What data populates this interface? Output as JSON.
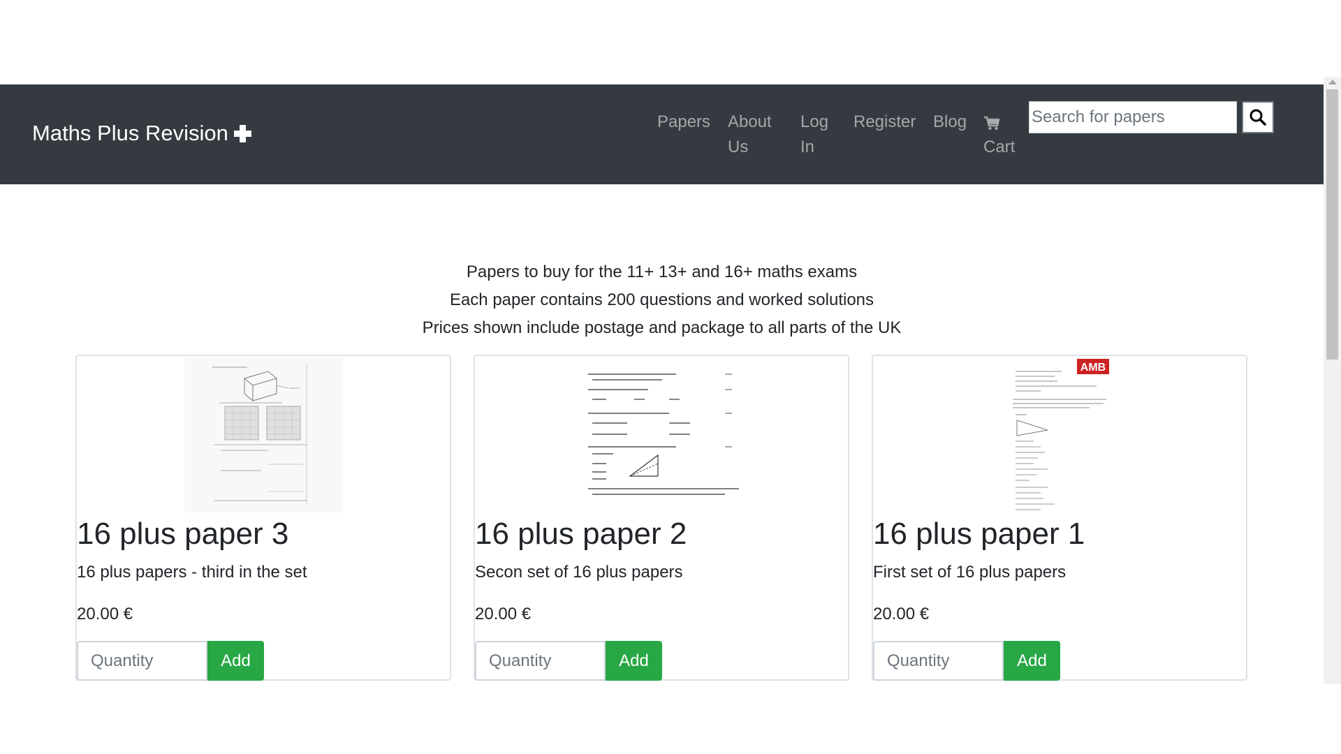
{
  "navbar": {
    "brand": "Maths Plus Revision",
    "links": [
      "Papers",
      "About Us",
      "Log In",
      "Register",
      "Blog"
    ],
    "cart_label": "Cart",
    "search_placeholder": "Search for papers",
    "background_color": "#343a40"
  },
  "intro": {
    "lines": [
      "Papers to buy for the 11+ 13+ and 16+ maths exams",
      "Each paper contains 200 questions and worked solutions",
      "Prices shown include postage and package to all parts of the UK"
    ]
  },
  "products": [
    {
      "title": "16 plus paper 3",
      "description": "16 plus papers - third in the set",
      "price": "20.00 €",
      "quantity_placeholder": "Quantity",
      "add_label": "Add"
    },
    {
      "title": "16 plus paper 2",
      "description": "Secon set of 16 plus papers",
      "price": "20.00 €",
      "quantity_placeholder": "Quantity",
      "add_label": "Add"
    },
    {
      "title": "16 plus paper 1",
      "description": "First set of 16 plus papers",
      "price": "20.00 €",
      "quantity_placeholder": "Quantity",
      "add_label": "Add"
    }
  ],
  "thumbnail_logo_text": "AMB",
  "colors": {
    "add_button": "#28a745",
    "brand_text": "#ffffff"
  },
  "icons": {
    "brand": "plus-icon",
    "cart": "shopping-cart-icon",
    "search": "search-icon"
  }
}
